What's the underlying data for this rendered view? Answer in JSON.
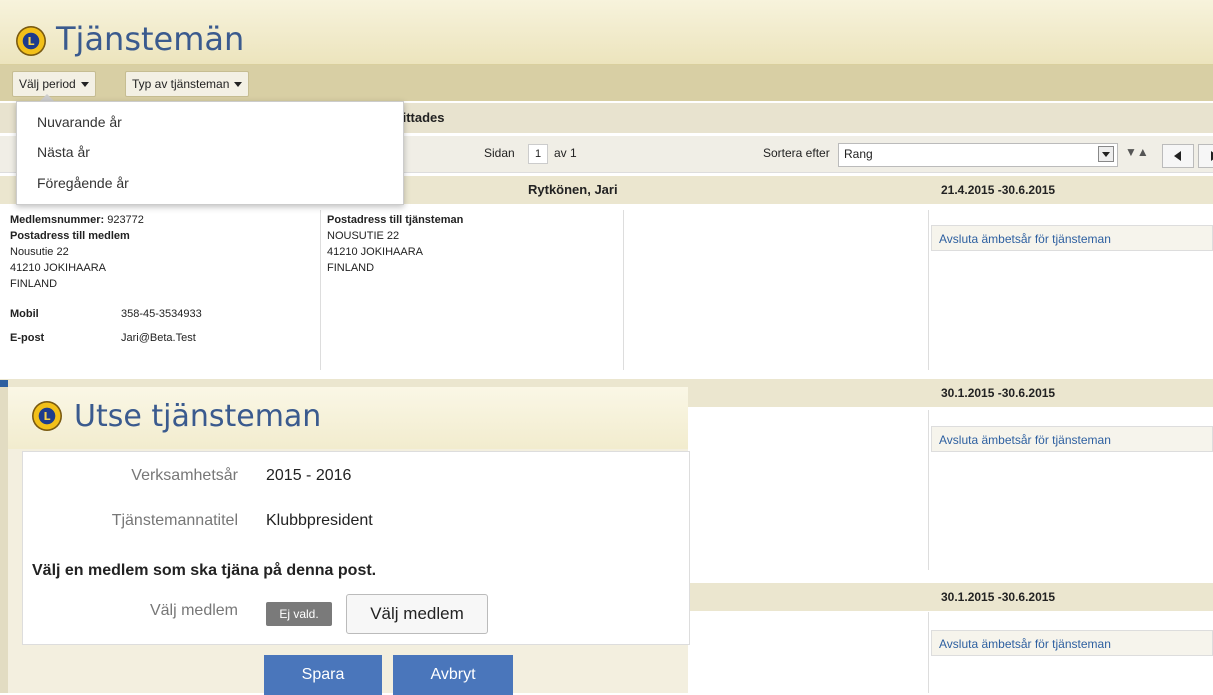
{
  "page": {
    "title": "Tjänstemän"
  },
  "filters": {
    "period_label": "Välj period",
    "type_label": "Typ av tjänsteman"
  },
  "period_menu": {
    "items": [
      "Nuvarande år",
      "Nästa år",
      "Föregående år"
    ]
  },
  "results": {
    "text_fragment": "r hittades"
  },
  "pager": {
    "page_label": "Sidan",
    "page_value": "1",
    "of_label": "av 1",
    "sort_label": "Sortera efter",
    "sort_value": "Rang",
    "sort_dir": "▼▲"
  },
  "records": [
    {
      "name": "Rytkönen, Jari",
      "period": "21.4.2015 -30.6.2015",
      "end_action": "Avsluta ämbetsår för tjänsteman"
    },
    {
      "name": "",
      "period": "30.1.2015 -30.6.2015",
      "end_action": "Avsluta ämbetsår för tjänsteman"
    },
    {
      "name": "",
      "period": "30.1.2015 -30.6.2015",
      "end_action": "Avsluta ämbetsår för tjänsteman"
    }
  ],
  "member": {
    "number_label": "Medlemsnummer:",
    "number": "923772",
    "postal_label": "Postadress till medlem",
    "address_lines": [
      "Nousutie 22",
      "41210 JOKIHAARA",
      "FINLAND"
    ],
    "mobile_label": "Mobil",
    "mobile": "358-45-3534933",
    "email_label": "E-post",
    "email": "Jari@Beta.Test",
    "officer_postal_label": "Postadress till tjänsteman",
    "officer_address_lines": [
      "NOUSUTIE 22",
      "41210 JOKIHAARA",
      "FINLAND"
    ]
  },
  "dialog": {
    "title": "Utse tjänsteman",
    "year_label": "Verksamhetsår",
    "year_value": "2015 - 2016",
    "title_label": "Tjänstemannatitel",
    "title_value": "Klubbpresident",
    "prompt": "Välj en medlem som ska tjäna på denna post.",
    "member_label": "Välj medlem",
    "not_set_badge": "Ej vald.",
    "choose_button": "Välj medlem",
    "save_button": "Spara",
    "cancel_button": "Avbryt"
  },
  "colors": {
    "accent_blue": "#2d5fa0",
    "title_blue": "#3a5a8e",
    "button_blue": "#4a76bb",
    "header_tan": "#d8cfa4"
  }
}
